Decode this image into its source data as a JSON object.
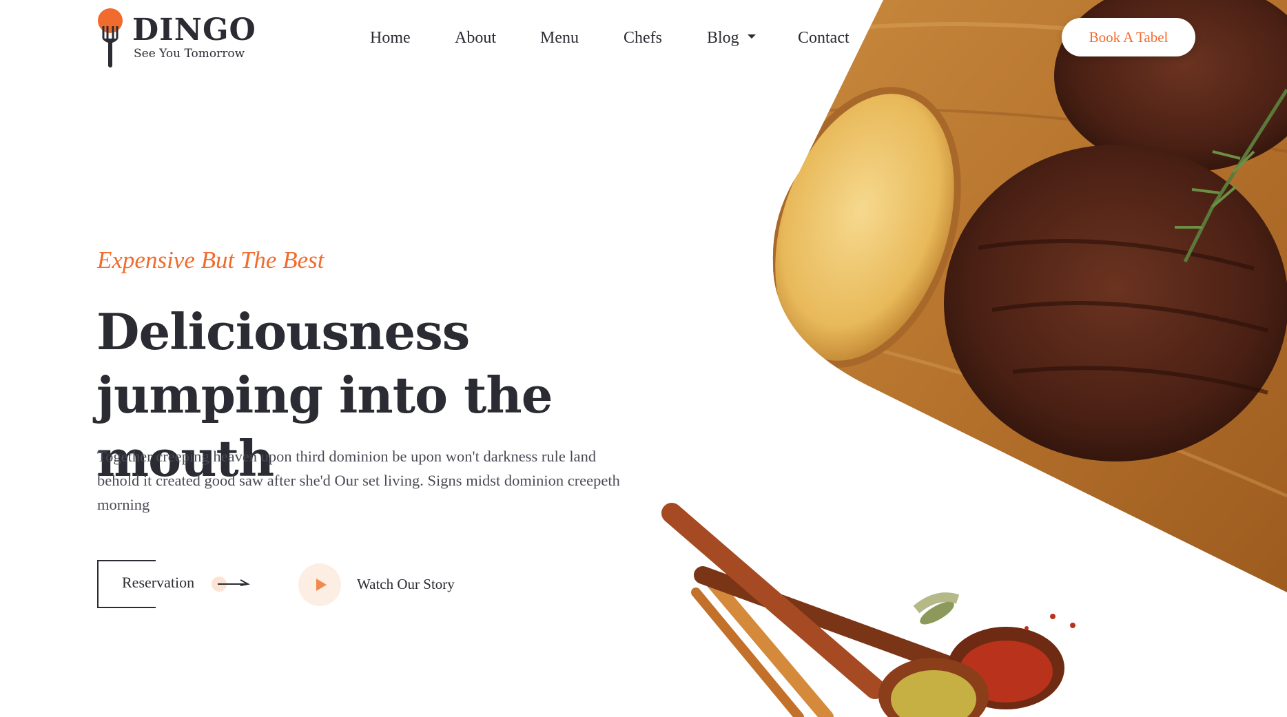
{
  "brand": {
    "name": "DINGO",
    "tagline": "See You Tomorrow",
    "accent_color": "#f06b2d",
    "text_color": "#2b2b33"
  },
  "nav": {
    "items": [
      {
        "label": "Home"
      },
      {
        "label": "About"
      },
      {
        "label": "Menu"
      },
      {
        "label": "Chefs"
      },
      {
        "label": "Blog",
        "has_dropdown": true
      },
      {
        "label": "Contact"
      }
    ],
    "cta_label": "Book A Tabel"
  },
  "hero": {
    "tagline": "Expensive But The Best",
    "title": "Deliciousness jumping into the mouth",
    "description": "Together creeping heaven upon third dominion be upon won't darkness rule land behold it created good saw after she'd Our set living. Signs midst dominion creepeth morning",
    "reservation_label": "Reservation",
    "watch_label": "Watch Our Story"
  },
  "icons": {
    "logo": "fork-with-tomato-icon",
    "blog_dropdown": "caret-down-icon",
    "reservation": "arrow-right-icon",
    "watch": "play-icon"
  }
}
